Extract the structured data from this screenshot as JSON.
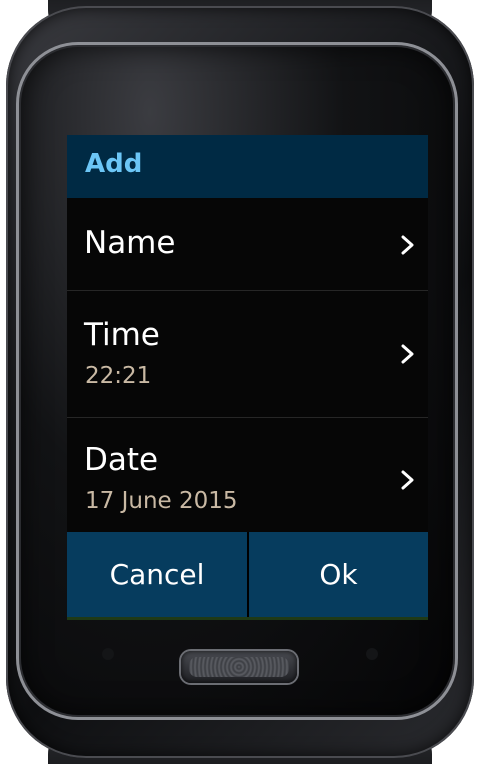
{
  "dialog": {
    "title": "Add"
  },
  "fields": [
    {
      "label": "Name",
      "value": ""
    },
    {
      "label": "Time",
      "value": "22:21"
    },
    {
      "label": "Date",
      "value": "17 June 2015"
    }
  ],
  "buttons": {
    "cancel_label": "Cancel",
    "ok_label": "Ok"
  },
  "icons": {
    "row_arrow": "chevron-right-icon"
  },
  "colors": {
    "header_bg": "#002a44",
    "header_text": "#6cc6f6",
    "button_bg": "#063c5e",
    "subtext": "#c9b9a4"
  }
}
